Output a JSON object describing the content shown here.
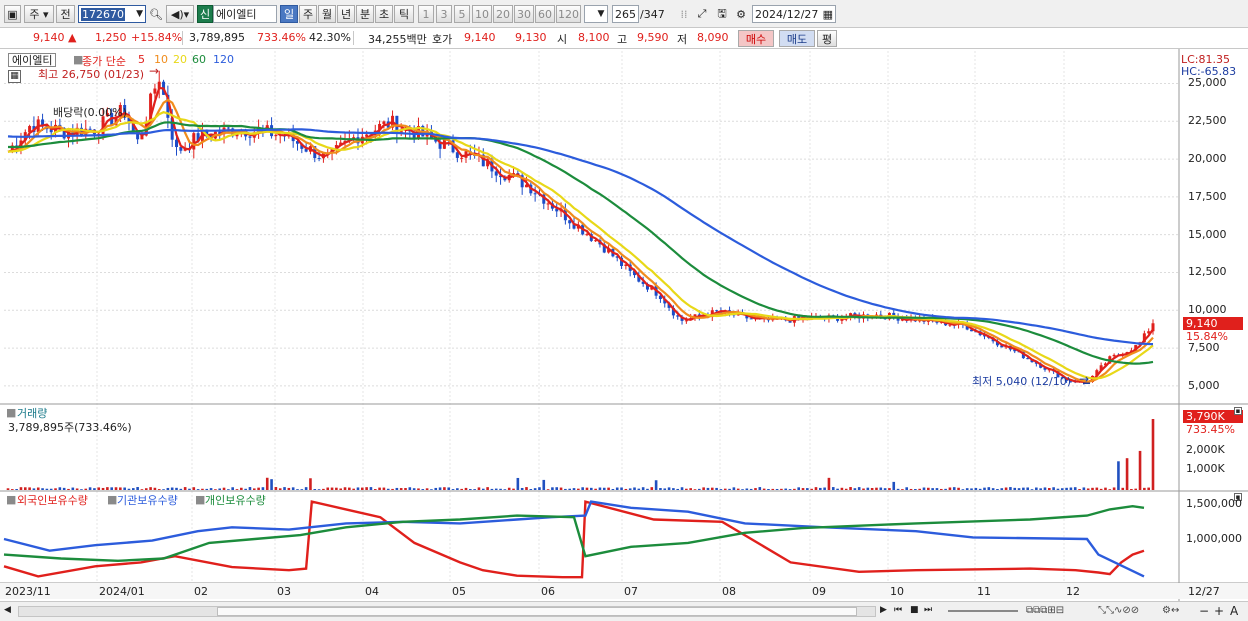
{
  "toolbar": {
    "period_type": "주",
    "prev_label": "전",
    "code": "172670",
    "company_badge": "신",
    "company": "에이엘티",
    "periods": [
      "일",
      "주",
      "월",
      "년",
      "분",
      "초",
      "틱"
    ],
    "minute_intervals": [
      "1",
      "3",
      "5",
      "10",
      "20",
      "30",
      "60",
      "120"
    ],
    "count": "265",
    "total": "/347",
    "date": "2024/12/27"
  },
  "quote": {
    "price": "9,140",
    "change": "1,250",
    "change_pct": "+15.84%",
    "volume": "3,789,895",
    "volume_ratio": "733.46%",
    "turnover": "42.30%",
    "amount": "34,255백만",
    "ask_label": "호가",
    "ask": "9,140",
    "bid": "9,130",
    "open_label": "시",
    "open": "8,100",
    "high_label": "고",
    "high": "9,590",
    "low_label": "저",
    "low": "8,090",
    "buy_label": "매수",
    "sell_label": "매도",
    "eval_label": "평"
  },
  "price_panel": {
    "name_tag": "에이엘티",
    "ma_label": "종가 단순",
    "ma_periods": [
      "5",
      "10",
      "20",
      "60",
      "120"
    ],
    "ma_colors": [
      "#e0201c",
      "#f08c1c",
      "#e8d818",
      "#1c8c3c",
      "#2c5cdc"
    ],
    "high_marker": "최고 26,750 (01/23)",
    "low_marker": "최저 5,040 (12/10)",
    "dividend_label": "배당락(0.00%)",
    "lc_label": "LC:81.35",
    "hc_label": "HC:-65.83",
    "price_tag": "9,140",
    "pct_tag": "15.84%",
    "y_ticks": [
      "25,000",
      "22,500",
      "20,000",
      "17,500",
      "15,000",
      "12,500",
      "10,000",
      "7,500",
      "5,000"
    ]
  },
  "volume_panel": {
    "title": "거래량",
    "value": "3,789,895주(733.46%)",
    "tag": "3,790K",
    "tag_pct": "733.45%",
    "y_ticks": [
      "2,000K",
      "1,000K"
    ]
  },
  "holding_panel": {
    "series": [
      "외국인보유수량",
      "기관보유수량",
      "개인보유수량"
    ],
    "colors": [
      "#e0201c",
      "#2c5cdc",
      "#1c8c3c"
    ],
    "y_ticks": [
      "1,500,000",
      "1,000,000"
    ]
  },
  "x_axis": [
    "2023/11",
    "2024/01",
    "02",
    "03",
    "04",
    "05",
    "06",
    "07",
    "08",
    "09",
    "10",
    "11",
    "12",
    "12/27"
  ]
}
